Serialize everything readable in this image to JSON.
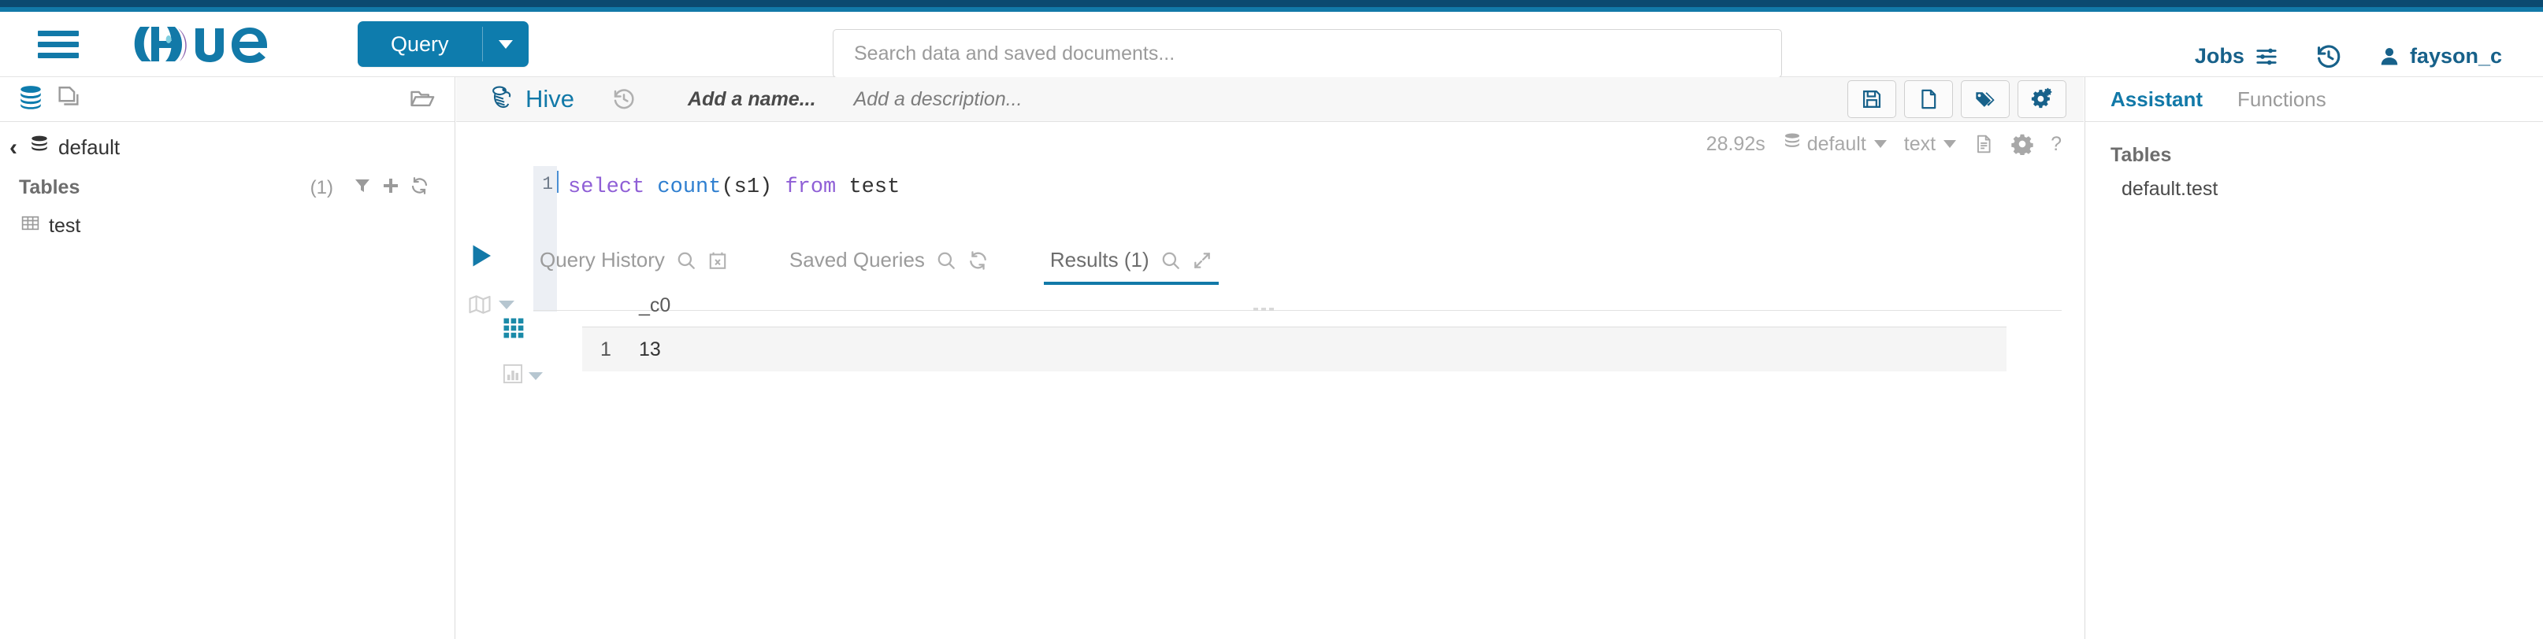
{
  "header": {
    "menu_icon": "hamburger-icon",
    "logo_text": "hue",
    "query_button": {
      "label": "Query",
      "caret_icon": "chevron-down-icon"
    },
    "search": {
      "placeholder": "Search data and saved documents...",
      "value": ""
    },
    "jobs": {
      "label": "Jobs",
      "icon": "sliders-icon"
    },
    "history_icon": "history-icon",
    "user": {
      "name": "fayson_c",
      "icon": "user-icon"
    },
    "accent_color": "#1279a8",
    "topbar_color": "#0b4a70"
  },
  "sidebar": {
    "icons": [
      {
        "name": "database-icon",
        "active": true
      },
      {
        "name": "documents-icon",
        "active": false
      },
      {
        "name": "open-folder-icon",
        "active": false
      }
    ],
    "back_icon": "chevron-left-icon",
    "database": {
      "label": "default",
      "icon": "database-icon"
    },
    "tables_header": {
      "label": "Tables",
      "count": "(1)",
      "filter_icon": "filter-icon",
      "add_icon": "plus-icon",
      "refresh_icon": "refresh-icon"
    },
    "tables": [
      {
        "label": "test",
        "icon": "table-icon"
      }
    ]
  },
  "editor": {
    "engine": {
      "label": "Hive",
      "icon": "hive-bee-icon"
    },
    "history_icon": "history-icon",
    "name_placeholder": "Add a name...",
    "description_placeholder": "Add a description...",
    "toolbar_buttons": [
      {
        "name": "save-button",
        "icon": "floppy-disk-icon"
      },
      {
        "name": "new-query-button",
        "icon": "file-icon"
      },
      {
        "name": "tags-button",
        "icon": "tags-icon"
      },
      {
        "name": "settings-button",
        "icon": "gears-icon"
      }
    ],
    "settings_bar": {
      "duration": "28.92s",
      "database": {
        "label": "default",
        "icon": "database-icon",
        "caret_icon": "chevron-down-icon"
      },
      "format": {
        "label": "text",
        "caret_icon": "chevron-down-icon"
      },
      "log_icon": "document-icon",
      "gear_icon": "gear-icon",
      "help_icon": "question-mark-icon"
    },
    "gutter_buttons": [
      {
        "name": "run-query-button",
        "icon": "play-icon"
      },
      {
        "name": "explain-button",
        "icon": "map-icon",
        "caret_icon": "chevron-down-icon"
      }
    ],
    "code": {
      "line_number": "1",
      "tokens": [
        {
          "text": "select",
          "type": "keyword"
        },
        {
          "text": " ",
          "type": "plain"
        },
        {
          "text": "count",
          "type": "function"
        },
        {
          "text": "(s1) ",
          "type": "plain"
        },
        {
          "text": "from",
          "type": "keyword"
        },
        {
          "text": " test",
          "type": "plain"
        }
      ],
      "full_text": "select count(s1) from test"
    },
    "drag_handle_icon": "drag-handle-icon"
  },
  "bottom_tabs": [
    {
      "label": "Query History",
      "active": false,
      "icons": [
        "search-icon",
        "calendar-clear-icon"
      ]
    },
    {
      "label": "Saved Queries",
      "active": false,
      "icons": [
        "search-icon",
        "refresh-icon"
      ]
    },
    {
      "label": "Results (1)",
      "active": true,
      "icons": [
        "search-icon",
        "expand-icon"
      ]
    }
  ],
  "results": {
    "grid_view_icon": "grid-icon",
    "chart_view_icon": "bar-chart-icon",
    "chart_caret_icon": "chevron-down-icon",
    "columns": [
      "",
      "_c0"
    ],
    "rows": [
      {
        "index": "1",
        "values": [
          "13"
        ]
      }
    ]
  },
  "assistant": {
    "tabs": [
      {
        "label": "Assistant",
        "active": true
      },
      {
        "label": "Functions",
        "active": false
      }
    ],
    "section_title": "Tables",
    "items": [
      {
        "label": "default.test"
      }
    ]
  }
}
